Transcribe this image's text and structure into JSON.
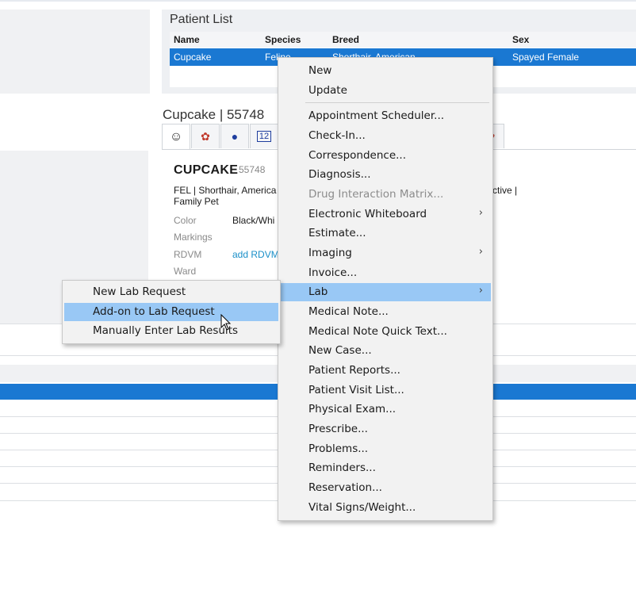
{
  "patient_list": {
    "title": "Patient List",
    "columns": [
      "Name",
      "Species",
      "Breed",
      "Sex"
    ],
    "selected_row": {
      "name": "Cupcake",
      "species": "Feline",
      "breed": "Shorthair, American",
      "sex": "Spayed Female"
    }
  },
  "patient": {
    "header": "Cupcake | 55748",
    "name": "CUPCAKE",
    "id": "55748",
    "desc_line1": "FEL | Shorthair, America",
    "desc_line2": "Family Pet",
    "desc_right": "ctive |",
    "fields": [
      {
        "label": "Color",
        "value": "Black/Whi"
      },
      {
        "label": "Markings",
        "value": ""
      },
      {
        "label": "RDVM",
        "value": "add RDVM"
      },
      {
        "label": "Ward",
        "value": ""
      }
    ]
  },
  "tabs": [
    {
      "icon": "patient-head-icon",
      "glyph": "☺"
    },
    {
      "icon": "pets-icon",
      "glyph": "✿"
    },
    {
      "icon": "medal-icon",
      "glyph": "●"
    },
    {
      "icon": "numbers-icon",
      "glyph": "12"
    }
  ],
  "context_menu": {
    "items": [
      {
        "label": "New"
      },
      {
        "label": "Update"
      },
      {
        "label": "Appointment Scheduler..."
      },
      {
        "label": "Check-In..."
      },
      {
        "label": "Correspondence..."
      },
      {
        "label": "Diagnosis..."
      },
      {
        "label": "Drug Interaction Matrix...",
        "disabled": true
      },
      {
        "label": "Electronic Whiteboard",
        "submenu": true
      },
      {
        "label": "Estimate..."
      },
      {
        "label": "Imaging",
        "submenu": true
      },
      {
        "label": "Invoice..."
      },
      {
        "label": "Lab",
        "submenu": true,
        "highlighted": true
      },
      {
        "label": "Medical Note..."
      },
      {
        "label": "Medical Note Quick Text..."
      },
      {
        "label": "New Case..."
      },
      {
        "label": "Patient Reports..."
      },
      {
        "label": "Patient Visit List..."
      },
      {
        "label": "Physical Exam..."
      },
      {
        "label": "Prescribe..."
      },
      {
        "label": "Problems..."
      },
      {
        "label": "Reminders..."
      },
      {
        "label": "Reservation..."
      },
      {
        "label": "Vital Signs/Weight..."
      }
    ],
    "submenu_arrow": "›"
  },
  "lab_submenu": {
    "items": [
      {
        "label": "New Lab Request"
      },
      {
        "label": "Add-on to Lab Request",
        "highlighted": true
      },
      {
        "label": "Manually Enter Lab Results"
      }
    ]
  },
  "colors": {
    "selection_blue": "#1a78d2",
    "menu_highlight": "#99c8f5",
    "menu_bg": "#f2f2f2",
    "link": "#1a8fc8"
  }
}
